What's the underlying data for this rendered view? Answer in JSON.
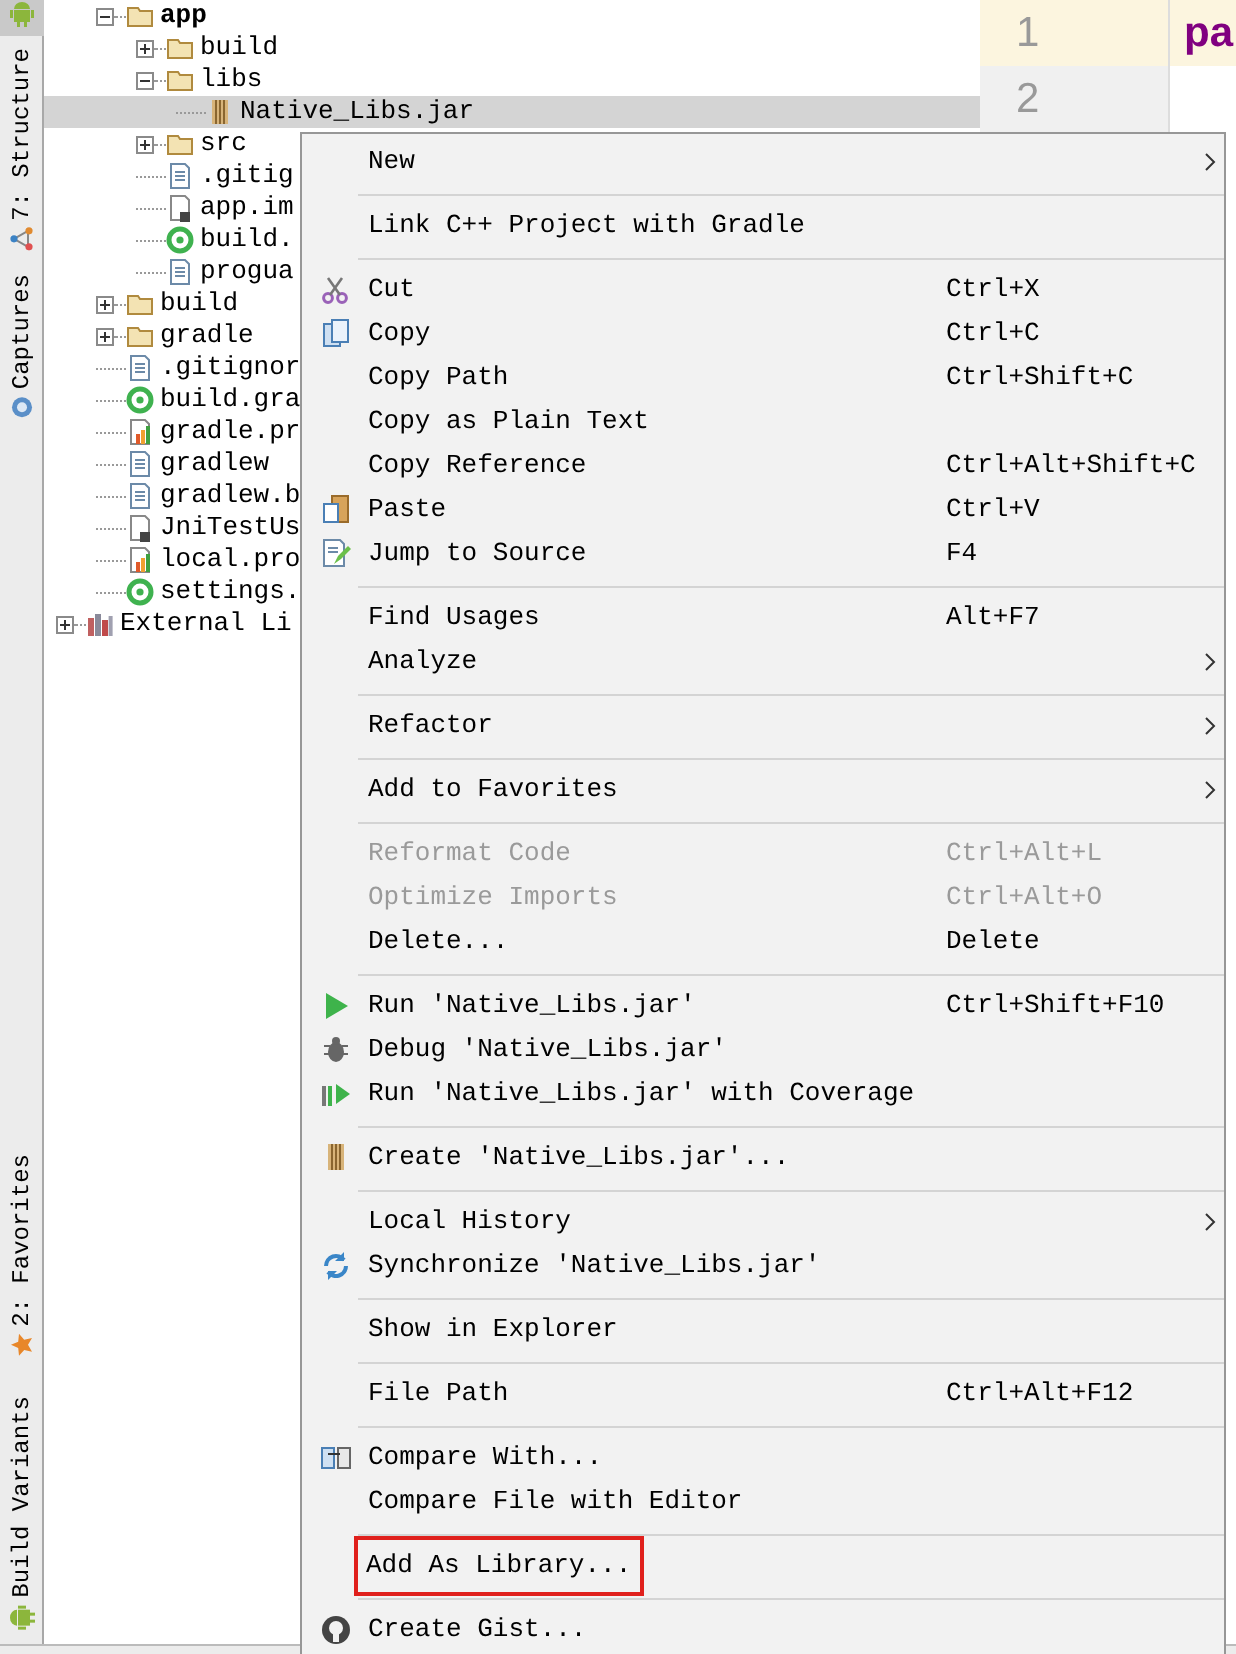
{
  "tool_strip": {
    "top": [
      {
        "label": "7: Structure"
      },
      {
        "label": "Captures"
      }
    ],
    "bottom": [
      {
        "label": "2: Favorites"
      },
      {
        "label": "Build Variants"
      }
    ]
  },
  "tree": [
    {
      "label": "app",
      "kind": "module",
      "expanded": true,
      "selected": false,
      "children": [
        {
          "label": "build",
          "kind": "folder",
          "expanded": false,
          "selected": false
        },
        {
          "label": "libs",
          "kind": "folder",
          "expanded": true,
          "selected": false,
          "children": [
            {
              "label": "Native_Libs.jar",
              "kind": "jar",
              "selected": true
            }
          ]
        },
        {
          "label": "src",
          "kind": "folder",
          "expanded": false,
          "selected": false
        },
        {
          "label": ".gitig",
          "kind": "text-file",
          "selected": false
        },
        {
          "label": "app.im",
          "kind": "module-file",
          "selected": false
        },
        {
          "label": "build.",
          "kind": "gradle-file",
          "selected": false
        },
        {
          "label": "progua",
          "kind": "text-file",
          "selected": false
        }
      ]
    },
    {
      "label": "build",
      "kind": "folder",
      "expanded": false,
      "selected": false
    },
    {
      "label": "gradle",
      "kind": "folder",
      "expanded": false,
      "selected": false
    },
    {
      "label": ".gitignor",
      "kind": "text-file",
      "selected": false
    },
    {
      "label": "build.gra",
      "kind": "gradle-file",
      "selected": false
    },
    {
      "label": "gradle.pr",
      "kind": "properties-file",
      "selected": false
    },
    {
      "label": "gradlew",
      "kind": "text-file",
      "selected": false
    },
    {
      "label": "gradlew.b",
      "kind": "text-file",
      "selected": false
    },
    {
      "label": "JniTestUs",
      "kind": "module-file",
      "selected": false
    },
    {
      "label": "local.pro",
      "kind": "properties-file",
      "selected": false
    },
    {
      "label": "settings.",
      "kind": "gradle-file",
      "selected": false
    },
    {
      "label": "External Li",
      "kind": "library",
      "expanded": false,
      "selected": false
    }
  ],
  "editor": {
    "lines": [
      {
        "number": "1",
        "text": "pa",
        "current": true
      },
      {
        "number": "2",
        "current": false
      }
    ]
  },
  "context_menu": {
    "items": [
      {
        "kind": "item",
        "label": "New",
        "submenu": true,
        "disabled": false,
        "outlined": false
      },
      {
        "kind": "separator"
      },
      {
        "kind": "item",
        "label": "Link C++ Project with Gradle",
        "submenu": false,
        "disabled": false,
        "outlined": false
      },
      {
        "kind": "separator"
      },
      {
        "kind": "item",
        "label": "Cut",
        "shortcut": "Ctrl+X",
        "submenu": false,
        "disabled": false,
        "outlined": false
      },
      {
        "kind": "item",
        "label": "Copy",
        "shortcut": "Ctrl+C",
        "submenu": false,
        "disabled": false,
        "outlined": false
      },
      {
        "kind": "item",
        "label": "Copy Path",
        "shortcut": "Ctrl+Shift+C",
        "submenu": false,
        "disabled": false,
        "outlined": false
      },
      {
        "kind": "item",
        "label": "Copy as Plain Text",
        "submenu": false,
        "disabled": false,
        "outlined": false
      },
      {
        "kind": "item",
        "label": "Copy Reference",
        "shortcut": "Ctrl+Alt+Shift+C",
        "submenu": false,
        "disabled": false,
        "outlined": false
      },
      {
        "kind": "item",
        "label": "Paste",
        "shortcut": "Ctrl+V",
        "submenu": false,
        "disabled": false,
        "outlined": false
      },
      {
        "kind": "item",
        "label": "Jump to Source",
        "shortcut": "F4",
        "submenu": false,
        "disabled": false,
        "outlined": false
      },
      {
        "kind": "separator"
      },
      {
        "kind": "item",
        "label": "Find Usages",
        "shortcut": "Alt+F7",
        "submenu": false,
        "disabled": false,
        "outlined": false
      },
      {
        "kind": "item",
        "label": "Analyze",
        "submenu": true,
        "disabled": false,
        "outlined": false
      },
      {
        "kind": "separator"
      },
      {
        "kind": "item",
        "label": "Refactor",
        "submenu": true,
        "disabled": false,
        "outlined": false
      },
      {
        "kind": "separator"
      },
      {
        "kind": "item",
        "label": "Add to Favorites",
        "submenu": true,
        "disabled": false,
        "outlined": false
      },
      {
        "kind": "separator"
      },
      {
        "kind": "item",
        "label": "Reformat Code",
        "shortcut": "Ctrl+Alt+L",
        "submenu": false,
        "disabled": true,
        "outlined": false
      },
      {
        "kind": "item",
        "label": "Optimize Imports",
        "shortcut": "Ctrl+Alt+O",
        "submenu": false,
        "disabled": true,
        "outlined": false
      },
      {
        "kind": "item",
        "label": "Delete...",
        "shortcut": "Delete",
        "submenu": false,
        "disabled": false,
        "outlined": false
      },
      {
        "kind": "separator"
      },
      {
        "kind": "item",
        "label": "Run 'Native_Libs.jar'",
        "shortcut": "Ctrl+Shift+F10",
        "submenu": false,
        "disabled": false,
        "outlined": false
      },
      {
        "kind": "item",
        "label": "Debug 'Native_Libs.jar'",
        "submenu": false,
        "disabled": false,
        "outlined": false
      },
      {
        "kind": "item",
        "label": "Run 'Native_Libs.jar' with Coverage",
        "submenu": false,
        "disabled": false,
        "outlined": false
      },
      {
        "kind": "separator"
      },
      {
        "kind": "item",
        "label": "Create 'Native_Libs.jar'...",
        "submenu": false,
        "disabled": false,
        "outlined": false
      },
      {
        "kind": "separator"
      },
      {
        "kind": "item",
        "label": "Local History",
        "submenu": true,
        "disabled": false,
        "outlined": false
      },
      {
        "kind": "item",
        "label": "Synchronize 'Native_Libs.jar'",
        "submenu": false,
        "disabled": false,
        "outlined": false
      },
      {
        "kind": "separator"
      },
      {
        "kind": "item",
        "label": "Show in Explorer",
        "submenu": false,
        "disabled": false,
        "outlined": false
      },
      {
        "kind": "separator"
      },
      {
        "kind": "item",
        "label": "File Path",
        "shortcut": "Ctrl+Alt+F12",
        "submenu": false,
        "disabled": false,
        "outlined": false
      },
      {
        "kind": "separator"
      },
      {
        "kind": "item",
        "label": "Compare With...",
        "submenu": false,
        "disabled": false,
        "outlined": false
      },
      {
        "kind": "item",
        "label": "Compare File with Editor",
        "submenu": false,
        "disabled": false,
        "outlined": false
      },
      {
        "kind": "separator"
      },
      {
        "kind": "item",
        "label": "Add As Library...",
        "submenu": false,
        "disabled": false,
        "outlined": true
      },
      {
        "kind": "separator"
      },
      {
        "kind": "item",
        "label": "Create Gist...",
        "submenu": false,
        "disabled": false,
        "outlined": false
      }
    ]
  }
}
